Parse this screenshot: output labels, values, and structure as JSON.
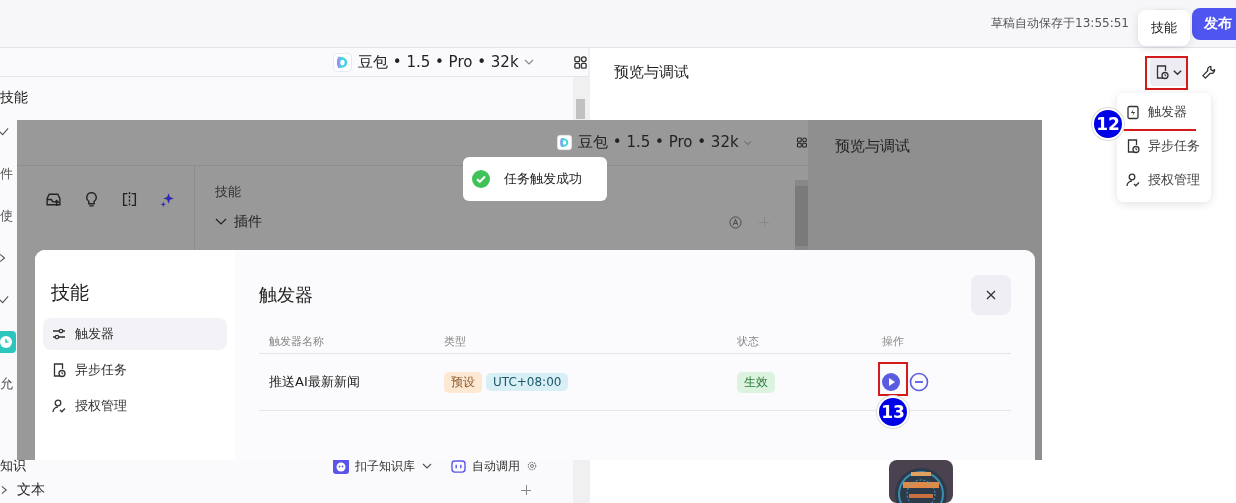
{
  "topbar": {
    "save_status": "草稿自动保存于13:55:51",
    "publish": "发布",
    "tooltip": "技能"
  },
  "toolbar": {
    "model": "豆包 • 1.5 • Pro • 32k",
    "preview_title": "预览与调试"
  },
  "skills_menu": {
    "items": [
      {
        "label": "触发器",
        "kind": "trigger"
      },
      {
        "label": "异步任务",
        "kind": "task"
      },
      {
        "label": "授权管理",
        "kind": "auth"
      }
    ]
  },
  "annotations": [
    {
      "label": "12"
    },
    {
      "label": "13"
    }
  ],
  "left_panel": {
    "heading": "技能",
    "fragments": [
      {
        "kind": "check"
      },
      {
        "kind": "text",
        "label": "件"
      },
      {
        "kind": "text",
        "label": "使"
      },
      {
        "kind": "chevron"
      },
      {
        "kind": "check"
      },
      {
        "kind": "clock"
      },
      {
        "kind": "text",
        "label": "允"
      }
    ],
    "knowledge_heading": "知识",
    "kb_source": "扣子知识库",
    "auto_call": "自动调用",
    "text_section": "文本"
  },
  "inset": {
    "model": "豆包 • 1.5 • Pro • 32k",
    "preview_title": "预览与调试",
    "skills_heading": "技能",
    "plugin_section": "插件",
    "toast": "任务触发成功",
    "dialog": {
      "title": "技能",
      "nav": [
        {
          "label": "触发器",
          "kind": "trigger",
          "selected": true
        },
        {
          "label": "异步任务",
          "kind": "task",
          "selected": false
        },
        {
          "label": "授权管理",
          "kind": "auth",
          "selected": false
        }
      ],
      "heading": "触发器",
      "columns": [
        "触发器名称",
        "类型",
        "状态",
        "操作"
      ],
      "rows": [
        {
          "name": "推送AI最新新闻",
          "tags": [
            {
              "label": "预设",
              "color": "#fde8d4"
            },
            {
              "label": "UTC+08:00",
              "color": "#d7eff5"
            }
          ],
          "status": "生效"
        }
      ]
    }
  }
}
